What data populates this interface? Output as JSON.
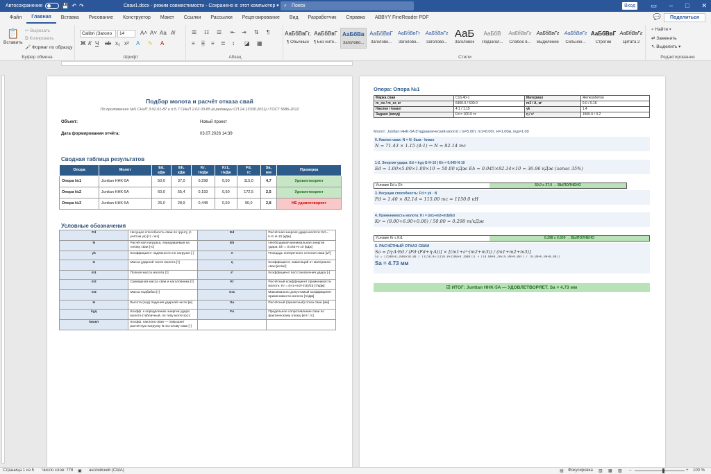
{
  "titlebar": {
    "autosave": "Автосохранение",
    "doc_title": "Сваи1.docx - режим совместимости - Сохранено в: этот компьютер ▾",
    "search": "Поиск",
    "signin": "Вход"
  },
  "menu": {
    "tabs": [
      "Файл",
      "Главная",
      "Вставка",
      "Рисование",
      "Конструктор",
      "Макет",
      "Ссылки",
      "Рассылки",
      "Рецензирование",
      "Вид",
      "Разработчик",
      "Справка",
      "ABBYY FineReader PDF"
    ],
    "share": "Поделиться"
  },
  "ribbon": {
    "clipboard": {
      "paste": "Вставить",
      "cut": "Вырезать",
      "copy": "Копировать",
      "format_painter": "Формат по образцу",
      "label": "Буфер обмена"
    },
    "font": {
      "name": "Calibri (Заголо",
      "size": "14",
      "label": "Шрифт"
    },
    "paragraph": {
      "label": "Абзац"
    },
    "styles": {
      "label": "Стили",
      "items": [
        {
          "preview": "АаБбВвГг,",
          "name": "¶ Обычный"
        },
        {
          "preview": "АаБбВвГ",
          "name": "¶ Без инте..."
        },
        {
          "preview": "АаБбВв",
          "name": "Заголово..."
        },
        {
          "preview": "АаБбВвГ",
          "name": "Заголово..."
        },
        {
          "preview": "АаБбВвГг",
          "name": "Заголово..."
        },
        {
          "preview": "АаБбВвГг",
          "name": "Заголово..."
        },
        {
          "preview": "АаБ",
          "name": "Заголовок"
        },
        {
          "preview": "АаБбВ",
          "name": "Подзагол..."
        },
        {
          "preview": "АаБбВвГг",
          "name": "Слабое в..."
        },
        {
          "preview": "АаБбВвГг",
          "name": "Выделение"
        },
        {
          "preview": "АаБбВвГг",
          "name": "Сильное..."
        },
        {
          "preview": "АаБбВвГ",
          "name": "Строгий"
        },
        {
          "preview": "АаБбВвГг",
          "name": "Цитата 2"
        }
      ]
    },
    "editing": {
      "find": "Найти",
      "replace": "Заменить",
      "select": "Выделить",
      "label": "Редактирование"
    }
  },
  "page1": {
    "title": "Подбор молота и расчёт отказа свай",
    "subtitle": "По приложению №5 СНиП 3.02.01-87 и п.5.7 СНиП 2.02.03-85 (в редакции СП 24.13330.2011) / ГОСТ 5686-2012",
    "object_label": "Объект:",
    "object_value": "Новый проект",
    "date_label": "Дата формирования отчёта:",
    "date_value": "03.07.2026 14:39",
    "summary_heading": "Сводная таблица результатов",
    "summary_headers": [
      "Опора",
      "Молот",
      "Ed,\nкДж",
      "Eh,\nкДж",
      "Kr,\nт/кДж",
      "Kr1,\nт/кДж",
      "Fd,\nтс",
      "Sa,\nмм",
      "Проверка"
    ],
    "summary_rows": [
      [
        "Опора №1",
        "Junttan HHK-5A",
        "50,0",
        "37,0",
        "0,298",
        "0,50",
        "115,0",
        "4,7",
        "Удовлетворяет"
      ],
      [
        "Опора №2",
        "Junttan HHK-5A",
        "60,0",
        "55,4",
        "0,193",
        "0,50",
        "172,5",
        "2,5",
        "Удовлетворяет"
      ],
      [
        "Опора №3",
        "Junttan HHK-5A",
        "25,0",
        "28,9",
        "0,448",
        "0,50",
        "90,0",
        "2,8",
        "НЕ удовлетворяет"
      ]
    ],
    "legend_heading": "Условные обозначения",
    "legend_rows": [
      [
        "Fd",
        "Несущая способность сваи по грунту (с учётом γk) [тс / кН]",
        "Ed",
        "Расчётная энергия удара молота: Ed = k·G·H·10 [кДж]"
      ],
      [
        "N",
        "Расчётная нагрузка, передаваемая на голову сваи [тс]",
        "Eh",
        "Необходимая минимальная энергия удара: Eh = 0,045·N·10 [кДж]"
      ],
      [
        "γk",
        "Коэффициент надёжности по нагрузке [-]",
        "A",
        "Площадь поперечного сечения сваи [м²]"
      ],
      [
        "G",
        "Масса ударной части молота [т]",
        "η",
        "Коэффициент, зависящий от материала сваи [кН/м²]"
      ],
      [
        "m1",
        "Полная масса молота [т]",
        "ε²",
        "Коэффициент восстановления удара [-]"
      ],
      [
        "m2",
        "Суммарная масса сваи и наголовника [т]",
        "Kr",
        "Расчётный коэффициент применимости молота: Kr = (m1+m2+m3)/Ed [т/кДж]"
      ],
      [
        "m3",
        "Масса подбабка [т]",
        "Kr1",
        "Максимально допустимый коэффициент применимости молота [т/кДж]"
      ],
      [
        "H",
        "Высота (ход) падения ударной части [м]",
        "Sa",
        "Расчётный (проектный) отказ сваи [мм]"
      ],
      [
        "kуд",
        "Коэфф. к определению энергии удара молота (табличный, по типу молота) [-]",
        "Fu",
        "Предельное сопротивление сваи по фактическому отказу [кН / тс]"
      ],
      [
        "kнакл",
        "Коэфф. наклона сваи — повышает расчётную нагрузку N на голову сваи [-]",
        "",
        ""
      ]
    ]
  },
  "page2": {
    "heading": "Опора: Опора №1",
    "params": [
      [
        "Марка сваи",
        "С16.40-1",
        "Материал",
        "Железобетон"
      ],
      [
        "m_св / m_нг, кг",
        "6400.0 / 500.0",
        "m3 / A, м²",
        "0.0 / 0.16"
      ],
      [
        "Наклон / kнакл",
        "4:1 / 1.15",
        "γk",
        "1.4"
      ],
      [
        "Задано (ввод)",
        "Fd = 100.0 тс",
        "η / ε²",
        "1500.0 / 0.2"
      ]
    ],
    "hammer_line": "Молот: Junttan HHK-5A (Гидравлический молот)  |  G=5.00т, m1=8.00т, H=1.00м, kуд=1.00",
    "step0_h": "0. Наклон сваи: N = N_базa · kнакл",
    "step0_f": "N = 71.43 × 1.15 (4:1)  →  N = 82.14 тс",
    "step1_h": "1-2. Энергия удара: Ed = kуд·G·H·10   |   Eh = 0.045·N·10",
    "step1_f": "Ed = 1.00×5.00×1.00×10 = 50.00 кДж   Eh = 0.045×82.14×10 = 36.96 кДж   (запас 35%)",
    "check1_l": "Условие Ed ≥ Eh",
    "check1_r": "50.0 ≥ 37.0 → ВЫПОЛНЕНО",
    "step3_h": "3. Несущая способность: Fd = γk · N",
    "step3_f": "Fd = 1.40 × 82.14 = 115.00 тс = 1150.0 кН",
    "step4_h": "4. Применимость молота: Kr = (m1+m2+m3)/Ed",
    "step4_f": "Kr = (8.00+6.90+0.00) / 50.00 = 0.298 т/кДж",
    "check2_l": "Условие Kr ≤ Kr1",
    "check2_r": "0.298 ≤ 0.500 → ВЫПОЛНЕНО",
    "step5_h": "5. РАСЧЁТНЫЙ ОТКАЗ СВАИ",
    "step5_f": "Sa = [η·A·Ed / (Fd·(Fd+η·A))] × [(m1+ε²·(m2+m3)) / (m1+m2+m3)]",
    "step5_sub": "Sa = [1500×0.1600×50.00 / (1150.0×(1150.0+1500×0.1600))] × [(8.00+0.20×(6.90+0.00)) / (8.00+6.90+0.00)]",
    "step5_res": "Sa = 4.73 мм",
    "result": "☑ ИТОГ: Junttan HHK-5A — УДОВЛЕТВОРЯЕТ. Sa = 4.73 мм"
  },
  "status": {
    "page": "Страница 1 из 5",
    "words": "Число слов: 778",
    "lang": "английский (США)",
    "focus": "Фокусировка",
    "zoom": "100 %"
  }
}
